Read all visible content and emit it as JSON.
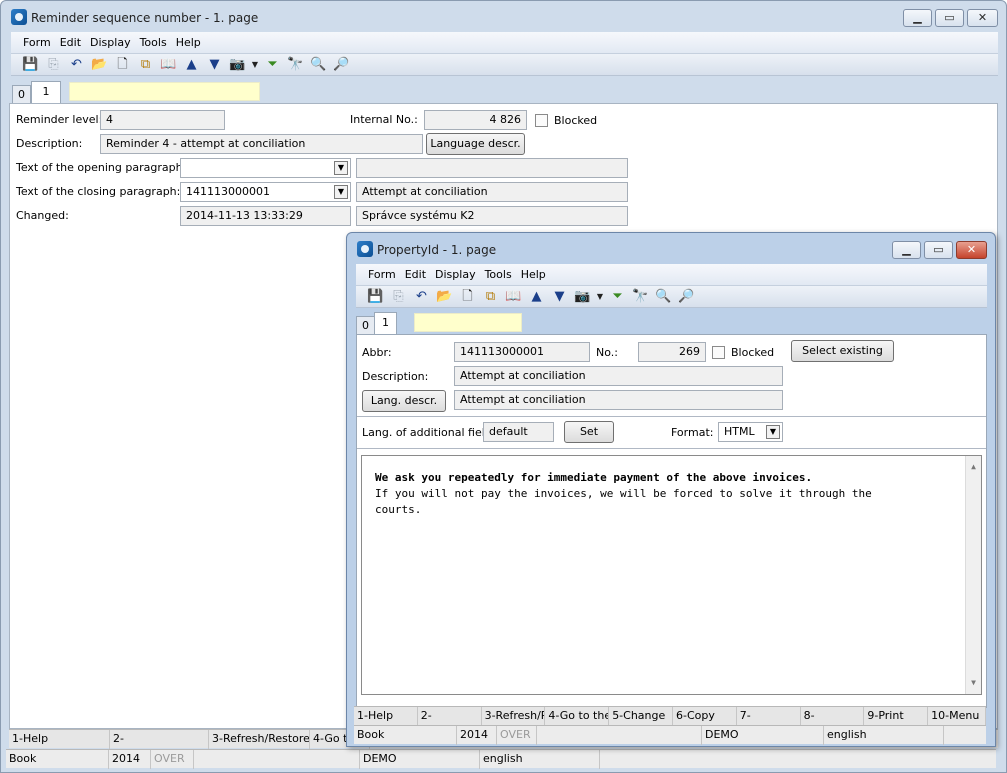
{
  "main": {
    "title": "Reminder sequence number - 1. page",
    "menu": [
      "Form",
      "Edit",
      "Display",
      "Tools",
      "Help"
    ],
    "tabs": [
      "0",
      "1"
    ],
    "fields": {
      "reminder_level_label": "Reminder level:",
      "reminder_level": "4",
      "internal_no_label": "Internal No.:",
      "internal_no": "4 826",
      "blocked_label": "Blocked",
      "description_label": "Description:",
      "description": "Reminder 4 - attempt at conciliation",
      "lang_descr_button": "Language descr.",
      "opening_label": "Text of the opening paragraph:",
      "opening_value": "",
      "opening_text": "",
      "closing_label": "Text of the closing paragraph:",
      "closing_value": "141113000001",
      "closing_text": "Attempt at conciliation",
      "changed_label": "Changed:",
      "changed_value": "2014-11-13 13:33:29",
      "changed_by": "Správce systému K2"
    },
    "fkeys": [
      "1-Help",
      "2-",
      "3-Refresh/Restore",
      "4-Go to"
    ],
    "status": [
      "Book",
      "2014",
      "OVER",
      "",
      "DEMO",
      "english"
    ]
  },
  "child": {
    "title": "PropertyId - 1. page",
    "menu": [
      "Form",
      "Edit",
      "Display",
      "Tools",
      "Help"
    ],
    "tabs": [
      "0",
      "1"
    ],
    "fields": {
      "abbr_label": "Abbr:",
      "abbr": "141113000001",
      "no_label": "No.:",
      "no": "269",
      "blocked_label": "Blocked",
      "select_existing": "Select existing",
      "description_label": "Description:",
      "description": "Attempt at conciliation",
      "lang_descr_button": "Lang. descr.",
      "lang_descr_value": "Attempt at conciliation",
      "lang_add_label": "Lang. of additional fields:",
      "lang_add_value": "default",
      "set_button": "Set",
      "format_label": "Format:",
      "format_value": "HTML"
    },
    "editor": {
      "line1": "We ask you repeatedly for immediate payment of the above invoices.",
      "line2": "If you will not pay the invoices, we will be forced to solve it through the",
      "line3": "courts."
    },
    "fkeys": [
      "1-Help",
      "2-",
      "3-Refresh/R",
      "4-Go to the l",
      "5-Change",
      "6-Copy",
      "7-",
      "8-",
      "9-Print",
      "10-Menu"
    ],
    "status": [
      "Book",
      "2014",
      "OVER",
      "",
      "DEMO",
      "english"
    ]
  },
  "icons": {
    "toolbar": [
      "save-icon",
      "save-as-icon",
      "undo-icon",
      "open-folder-icon",
      "new-document-icon",
      "copy-icon",
      "book-icon",
      "arrow-up-icon",
      "arrow-down-icon",
      "camera-icon",
      "dropdown-icon",
      "filter-icon",
      "binoculars-icon",
      "find-next-icon",
      "find-prev-icon"
    ]
  }
}
